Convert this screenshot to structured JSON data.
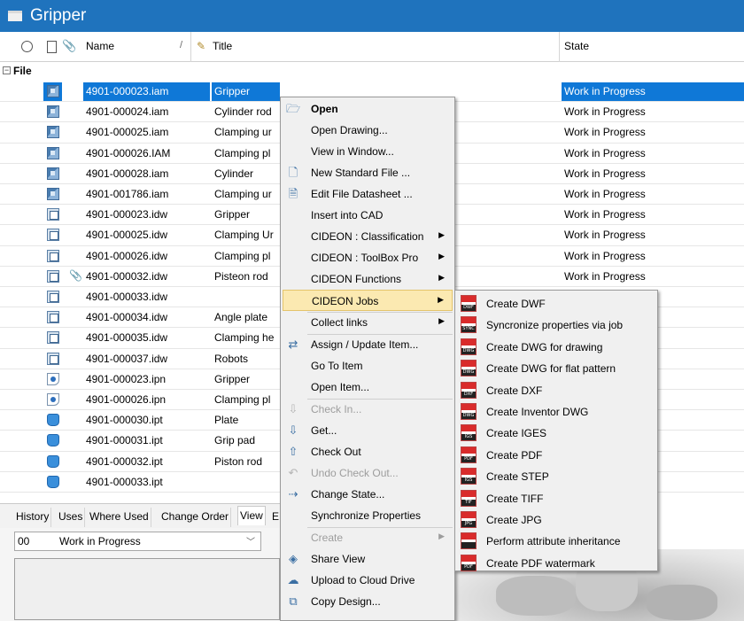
{
  "window": {
    "title": "Gripper"
  },
  "columns": {
    "name": "Name",
    "title": "Title",
    "state": "State"
  },
  "group": {
    "label": "File",
    "toggle": "⊟"
  },
  "rows": [
    {
      "name": "4901-000023.iam",
      "title": "Gripper",
      "state": "Work in Progress",
      "icon": "assembly-icon",
      "selected": true
    },
    {
      "name": "4901-000024.iam",
      "title": "Cylinder rod",
      "state": "Work in Progress",
      "icon": "assembly-icon"
    },
    {
      "name": "4901-000025.iam",
      "title": "Clamping ur",
      "state": "Work in Progress",
      "icon": "assembly-icon"
    },
    {
      "name": "4901-000026.IAM",
      "title": "Clamping pl",
      "state": "Work in Progress",
      "icon": "assembly-icon"
    },
    {
      "name": "4901-000028.iam",
      "title": "Cylinder",
      "state": "Work in Progress",
      "icon": "assembly-icon"
    },
    {
      "name": "4901-001786.iam",
      "title": "Clamping ur",
      "state": "Work in Progress",
      "icon": "assembly-icon"
    },
    {
      "name": "4901-000023.idw",
      "title": "Gripper",
      "state": "Work in Progress",
      "icon": "drawing-icon"
    },
    {
      "name": "4901-000025.idw",
      "title": "Clamping Ur",
      "state": "Work in Progress",
      "icon": "drawing-icon"
    },
    {
      "name": "4901-000026.idw",
      "title": "Clamping pl",
      "state": "Work in Progress",
      "icon": "drawing-icon"
    },
    {
      "name": "4901-000032.idw",
      "title": "Pisteon rod",
      "state": "Work in Progress",
      "icon": "drawing-icon",
      "attachment": true
    },
    {
      "name": "4901-000033.idw",
      "title": "",
      "state": "",
      "icon": "drawing-icon"
    },
    {
      "name": "4901-000034.idw",
      "title": "Angle plate",
      "state": "",
      "icon": "drawing-icon"
    },
    {
      "name": "4901-000035.idw",
      "title": "Clamping he",
      "state": "",
      "icon": "drawing-icon"
    },
    {
      "name": "4901-000037.idw",
      "title": "Robots",
      "state": "",
      "icon": "drawing-icon"
    },
    {
      "name": "4901-000023.ipn",
      "title": "Gripper",
      "state": "",
      "icon": "presentation-icon"
    },
    {
      "name": "4901-000026.ipn",
      "title": "Clamping pl",
      "state": "",
      "icon": "presentation-icon"
    },
    {
      "name": "4901-000030.ipt",
      "title": "Plate",
      "state": "",
      "icon": "part-icon"
    },
    {
      "name": "4901-000031.ipt",
      "title": "Grip pad",
      "state": "",
      "icon": "part-icon"
    },
    {
      "name": "4901-000032.ipt",
      "title": "Piston rod",
      "state": "",
      "icon": "part-icon"
    },
    {
      "name": "4901-000033.ipt",
      "title": "",
      "state": "",
      "icon": "part-icon"
    }
  ],
  "tabs": [
    "History",
    "Uses",
    "Where Used",
    "Change Order",
    "View",
    "E"
  ],
  "state_select": {
    "code": "00",
    "value": "Work in Progress"
  },
  "context_menu": [
    {
      "label": "Open",
      "bold": true,
      "icon": "open-folder-icon",
      "glyph": "🗁"
    },
    {
      "label": "Open Drawing..."
    },
    {
      "label": "View in Window..."
    },
    {
      "label": "New Standard File ...",
      "icon": "new-file-icon",
      "glyph": "🗋"
    },
    {
      "label": "Edit File Datasheet ...",
      "icon": "datasheet-icon",
      "glyph": "🗎"
    },
    {
      "label": "Insert into CAD"
    },
    {
      "label": "CIDEON : Classification",
      "submenu": true
    },
    {
      "label": "CIDEON : ToolBox Pro",
      "submenu": true
    },
    {
      "label": "CIDEON Functions",
      "submenu": true
    },
    {
      "label": "CIDEON Jobs",
      "submenu": true,
      "highlight": true
    },
    {
      "label": "Collect links",
      "submenu": true,
      "sep_before": true
    },
    {
      "label": "Assign / Update Item...",
      "icon": "assign-item-icon",
      "glyph": "⇄",
      "sep_before": true
    },
    {
      "label": "Go To Item"
    },
    {
      "label": "Open Item..."
    },
    {
      "label": "Check In...",
      "disabled": true,
      "icon": "check-in-icon",
      "glyph": "⇩",
      "sep_before": true
    },
    {
      "label": "Get...",
      "icon": "get-icon",
      "glyph": "⇩"
    },
    {
      "label": "Check Out",
      "icon": "check-out-icon",
      "glyph": "⇧"
    },
    {
      "label": "Undo Check Out...",
      "disabled": true,
      "icon": "undo-checkout-icon",
      "glyph": "↶"
    },
    {
      "label": "Change State...",
      "icon": "change-state-icon",
      "glyph": "⇢"
    },
    {
      "label": "Synchronize Properties"
    },
    {
      "label": "Create",
      "disabled": true,
      "submenu": true,
      "sep_before": true
    },
    {
      "label": "Share View",
      "icon": "share-view-icon",
      "glyph": "◈"
    },
    {
      "label": "Upload to Cloud Drive",
      "icon": "cloud-upload-icon",
      "glyph": "☁"
    },
    {
      "label": "Copy Design...",
      "icon": "copy-design-icon",
      "glyph": "⧉"
    }
  ],
  "submenu": [
    {
      "label": "Create DWF",
      "tag": "DWF"
    },
    {
      "label": "Syncronize properties via job",
      "tag": "SYNC"
    },
    {
      "label": "Create DWG for drawing",
      "tag": "DWG"
    },
    {
      "label": "Create DWG for flat pattern",
      "tag": "DWG"
    },
    {
      "label": "Create DXF",
      "tag": "DXF"
    },
    {
      "label": "Create Inventor DWG",
      "tag": "DWG"
    },
    {
      "label": "Create IGES",
      "tag": "IGS"
    },
    {
      "label": "Create PDF",
      "tag": "PDF"
    },
    {
      "label": "Create STEP",
      "tag": "IGS"
    },
    {
      "label": "Create TIFF",
      "tag": "TIF"
    },
    {
      "label": "Create JPG",
      "tag": "JPG"
    },
    {
      "label": "Perform attribute inheritance",
      "tag": ""
    },
    {
      "label": "Create PDF watermark",
      "tag": "PDF"
    }
  ],
  "colors": {
    "titlebar": "#1f73bd",
    "selection": "#0f78d7",
    "menu_highlight": "#fbe9b1"
  }
}
